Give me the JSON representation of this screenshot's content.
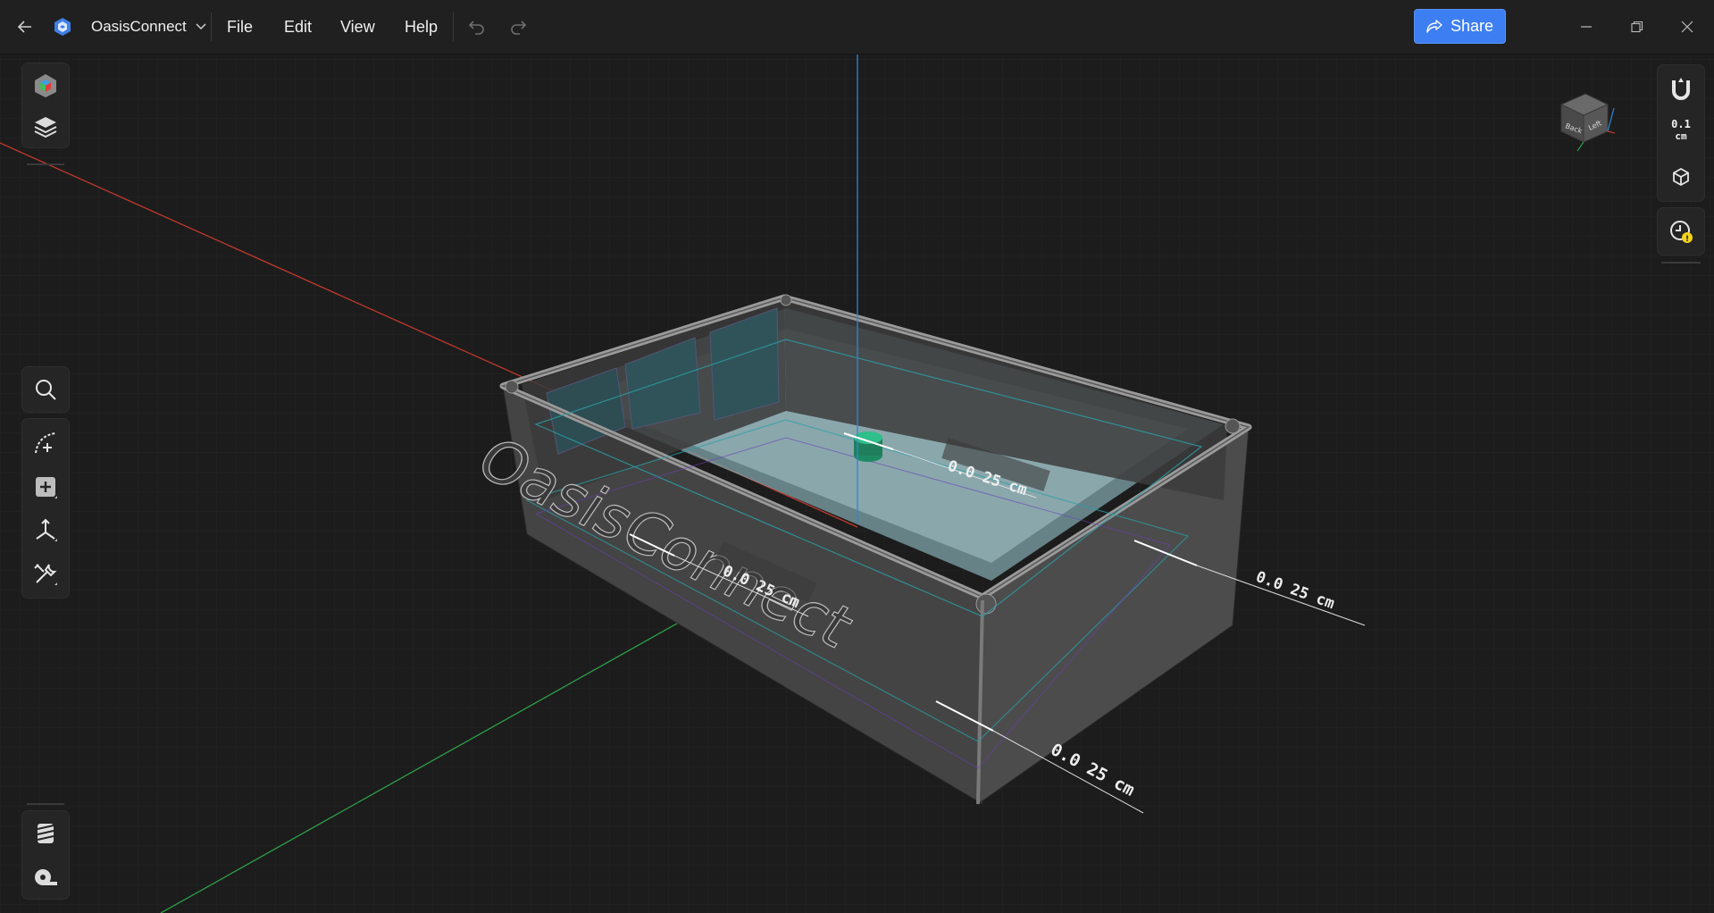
{
  "app": {
    "name": "OasisConnect"
  },
  "menu": {
    "file": "File",
    "edit": "Edit",
    "view": "View",
    "help": "Help"
  },
  "toolbar": {
    "share_label": "Share"
  },
  "snap": {
    "value": "0.1",
    "unit": "cm"
  },
  "viewcube": {
    "back_label": "Back",
    "left_label": "Left"
  },
  "model": {
    "embossed_text": "OasisConnect"
  },
  "dimensions": {
    "inner_center": "0.0 25 cm",
    "inner_left": "0.0 25 cm",
    "right_side": "0.0 25 cm",
    "front_corner": "0.0 25 cm"
  },
  "colors": {
    "accent": "#3d7ef2",
    "x_axis": "#c0392b",
    "y_axis": "#2e9e4a",
    "z_axis": "#2f86d6",
    "warning": "#f2d21b"
  }
}
